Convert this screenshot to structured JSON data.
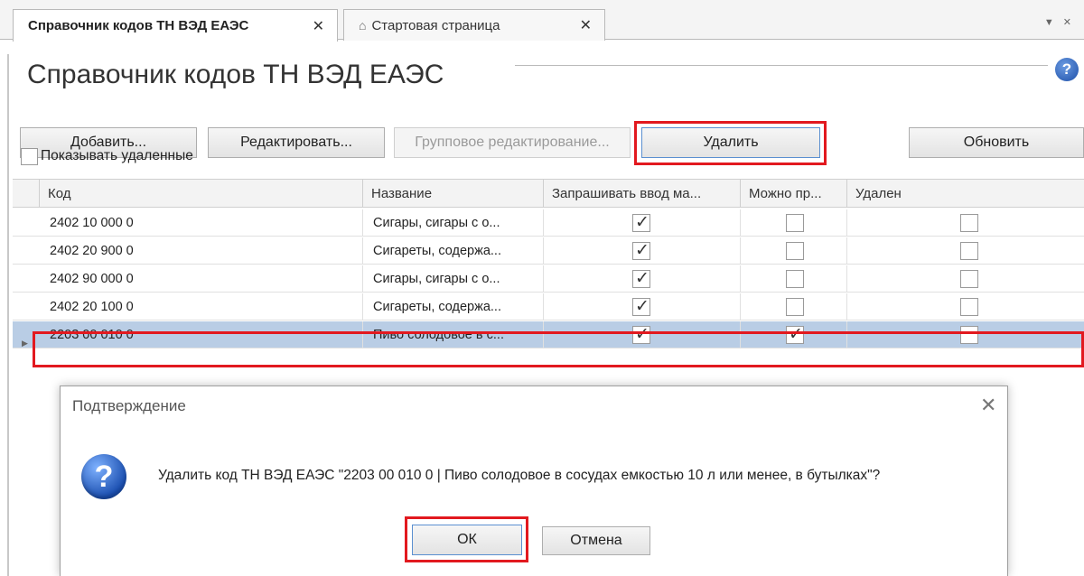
{
  "tabs": [
    {
      "label": "Справочник кодов ТН ВЭД ЕАЭС"
    },
    {
      "label": "Стартовая страница"
    }
  ],
  "page": {
    "title": "Справочник кодов ТН ВЭД ЕАЭС"
  },
  "toolbar": {
    "add": "Добавить...",
    "edit": "Редактировать...",
    "group_edit": "Групповое редактирование...",
    "delete": "Удалить",
    "refresh": "Обновить"
  },
  "show_deleted": {
    "label": "Показывать удаленные",
    "checked": false
  },
  "grid": {
    "columns": [
      "Код",
      "Название",
      "Запрашивать ввод ма...",
      "Можно пр...",
      "Удален"
    ],
    "rows": [
      {
        "code": "2402 10 000 0",
        "name": "Сигары, сигары с о...",
        "ask": true,
        "can": false,
        "deleted": false
      },
      {
        "code": "2402 20 900 0",
        "name": "Сигареты, содержа...",
        "ask": true,
        "can": false,
        "deleted": false
      },
      {
        "code": "2402 90 000 0",
        "name": "Сигары, сигары с о...",
        "ask": true,
        "can": false,
        "deleted": false
      },
      {
        "code": "2402 20 100 0",
        "name": "Сигареты, содержа...",
        "ask": true,
        "can": false,
        "deleted": false
      },
      {
        "code": "2203 00 010 0",
        "name": "Пиво солодовое в с...",
        "ask": true,
        "can": true,
        "deleted": false
      }
    ]
  },
  "dialog": {
    "title": "Подтверждение",
    "message": "Удалить код ТН ВЭД ЕАЭС \"2203 00 010 0 | Пиво солодовое в сосудах емкостью 10 л или менее, в бутылках\"?",
    "ok": "ОК",
    "cancel": "Отмена"
  },
  "colors": {
    "highlight": "#e2191f",
    "selected_row": "#b9cde5"
  }
}
